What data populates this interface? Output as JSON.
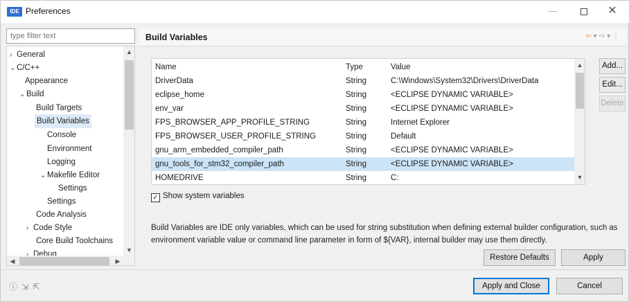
{
  "window": {
    "app_badge": "IDE",
    "title": "Preferences",
    "minimize": "—",
    "close": "✕"
  },
  "sidebar": {
    "filter_placeholder": "type filter text",
    "items": [
      {
        "label": "General",
        "arrow": "›"
      },
      {
        "label": "C/C++",
        "arrow": "⌄"
      },
      {
        "label": "Appearance",
        "arrow": ""
      },
      {
        "label": "Build",
        "arrow": "⌄"
      },
      {
        "label": "Build Targets",
        "arrow": ""
      },
      {
        "label": "Build Variables",
        "arrow": ""
      },
      {
        "label": "Console",
        "arrow": ""
      },
      {
        "label": "Environment",
        "arrow": ""
      },
      {
        "label": "Logging",
        "arrow": ""
      },
      {
        "label": "Makefile Editor",
        "arrow": "⌄"
      },
      {
        "label": "Settings",
        "arrow": ""
      },
      {
        "label": "Settings",
        "arrow": ""
      },
      {
        "label": "Code Analysis",
        "arrow": ""
      },
      {
        "label": "Code Style",
        "arrow": "›"
      },
      {
        "label": "Core Build Toolchains",
        "arrow": ""
      },
      {
        "label": "Debug",
        "arrow": "›"
      }
    ]
  },
  "main": {
    "section_title": "Build Variables",
    "table": {
      "headers": [
        "Name",
        "Type",
        "Value"
      ],
      "rows": [
        [
          "DriverData",
          "String",
          "C:\\Windows\\System32\\Drivers\\DriverData"
        ],
        [
          "eclipse_home",
          "String",
          "<ECLIPSE DYNAMIC VARIABLE>"
        ],
        [
          "env_var",
          "String",
          "<ECLIPSE DYNAMIC VARIABLE>"
        ],
        [
          "FPS_BROWSER_APP_PROFILE_STRING",
          "String",
          "Internet Explorer"
        ],
        [
          "FPS_BROWSER_USER_PROFILE_STRING",
          "String",
          "Default"
        ],
        [
          "gnu_arm_embedded_compiler_path",
          "String",
          "<ECLIPSE DYNAMIC VARIABLE>"
        ],
        [
          "gnu_tools_for_stm32_compiler_path",
          "String",
          "<ECLIPSE DYNAMIC VARIABLE>"
        ],
        [
          "HOMEDRIVE",
          "String",
          "C:"
        ]
      ],
      "selected_row": 6
    },
    "buttons": {
      "add": "Add...",
      "edit": "Edit...",
      "delete": "Delete"
    },
    "show_system_variables": {
      "label": "Show system variables",
      "checked": true,
      "mark": "✓"
    },
    "description": "Build Variables are IDE only variables, which can be used for string substitution when defining external builder configuration, such as environment variable value or command line parameter in form of ${VAR}, internal builder may use them directly.",
    "restore_defaults": "Restore Defaults",
    "apply": "Apply"
  },
  "footer": {
    "apply_and_close": "Apply and Close",
    "cancel": "Cancel",
    "icons": [
      "help-icon",
      "import-icon",
      "export-icon"
    ]
  },
  "colors": {
    "selection": "#cce4f7",
    "tree_selection": "#dde9f6",
    "primary_border": "#0078d7"
  }
}
